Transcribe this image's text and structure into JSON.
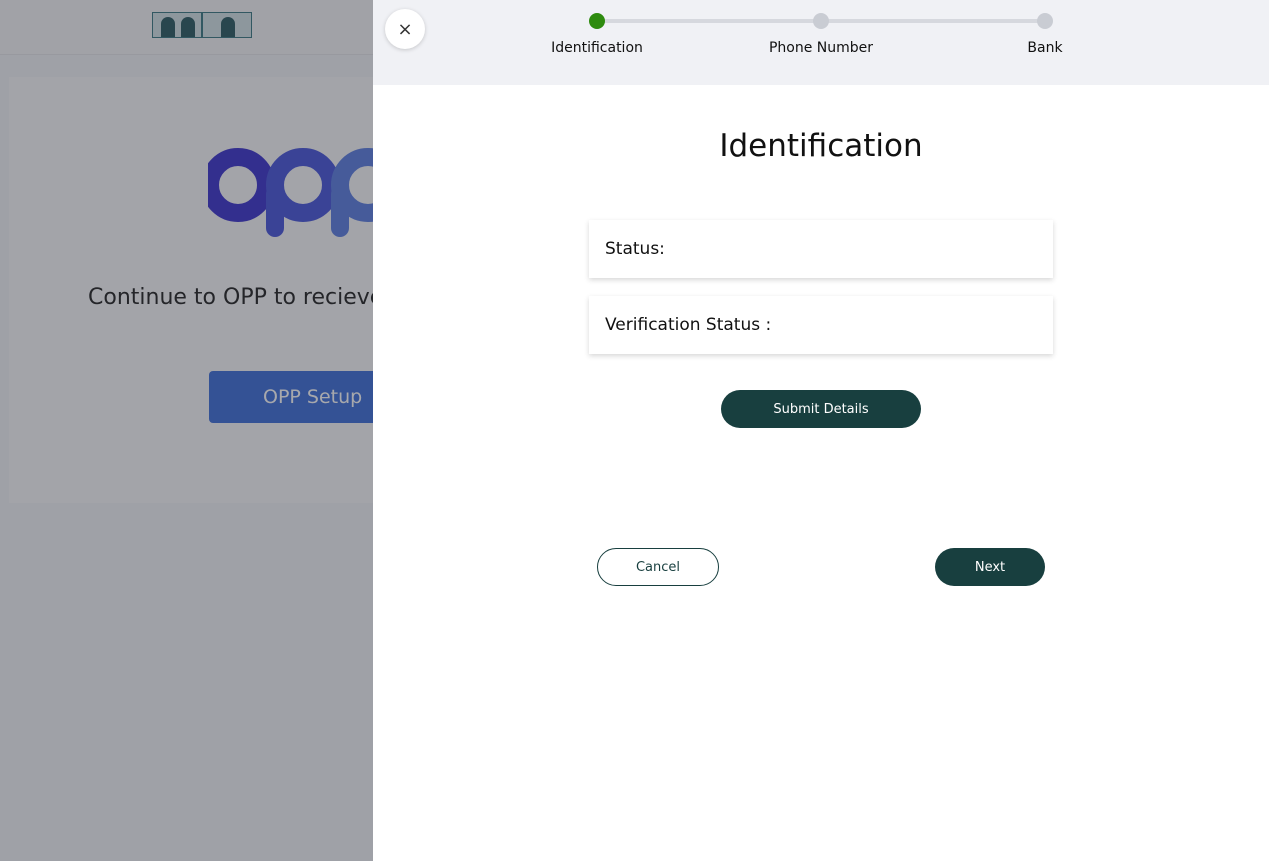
{
  "background": {
    "main_text": "Continue to OPP to recieve",
    "setup_button": "OPP Setup"
  },
  "drawer": {
    "close_icon": "×",
    "steps": [
      {
        "label": "Identification",
        "active": true
      },
      {
        "label": "Phone Number",
        "active": false
      },
      {
        "label": "Bank",
        "active": false
      }
    ],
    "title": "Identification",
    "rows": [
      {
        "label": "Status:",
        "value": ""
      },
      {
        "label": "Verification Status :",
        "value": ""
      }
    ],
    "submit_label": "Submit Details",
    "cancel_label": "Cancel",
    "next_label": "Next"
  },
  "colors": {
    "active_step": "#2e8b0f",
    "primary_button": "#183f3f",
    "opp_button": "#2f63d6"
  }
}
